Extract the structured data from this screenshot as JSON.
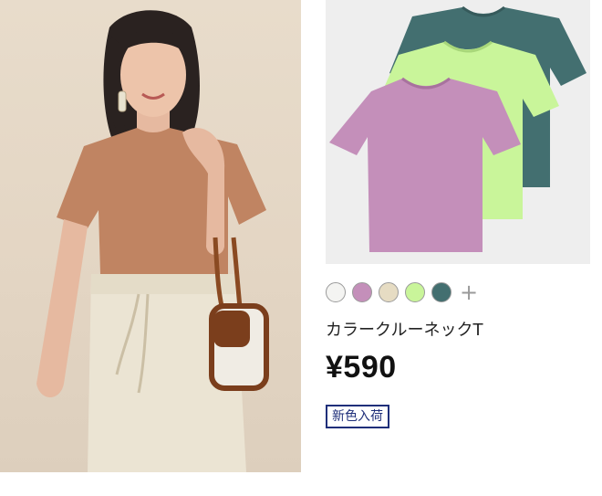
{
  "model_photo": {
    "alt": "model-in-tee"
  },
  "product": {
    "name": "カラークルーネックT",
    "price": "¥590",
    "badge": "新色入荷",
    "more_colors_label": "+",
    "colors": [
      {
        "name": "white",
        "hex": "#f4f4f2"
      },
      {
        "name": "pink",
        "hex": "#c48fba"
      },
      {
        "name": "beige",
        "hex": "#e6dcc3"
      },
      {
        "name": "lime",
        "hex": "#c9f59a"
      },
      {
        "name": "teal",
        "hex": "#436f70"
      }
    ]
  },
  "colors": {
    "badge_border": "#1f2f7a",
    "shirt_teal": "#436f70",
    "shirt_lime": "#c9f59a",
    "shirt_pink": "#c48fba",
    "model_shirt": "#c08462",
    "model_pants": "#ebe4d3"
  }
}
